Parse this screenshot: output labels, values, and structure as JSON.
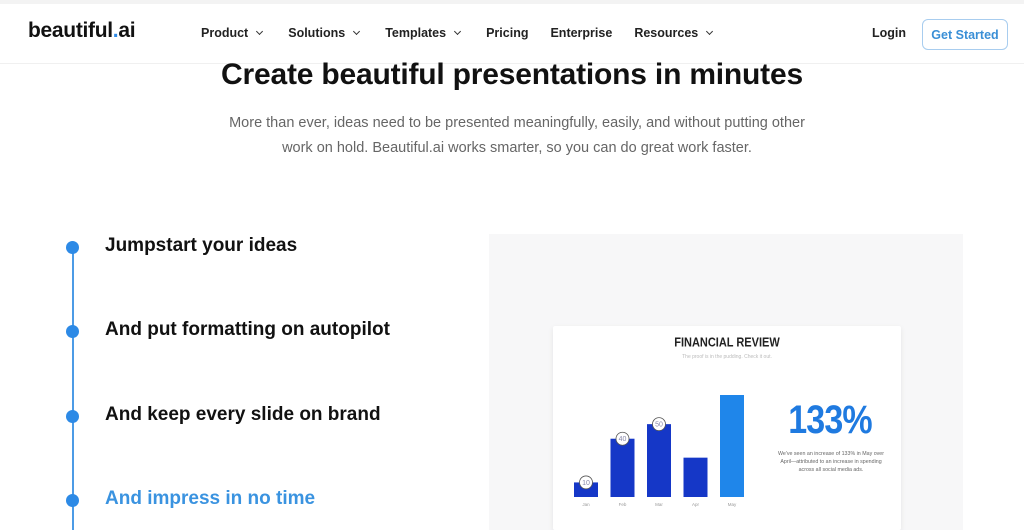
{
  "nav": {
    "logo": {
      "text": "beautiful",
      "dot": ".",
      "suffix": "ai"
    },
    "menu": [
      {
        "label": "Product",
        "has_dropdown": true
      },
      {
        "label": "Solutions",
        "has_dropdown": true
      },
      {
        "label": "Templates",
        "has_dropdown": true
      },
      {
        "label": "Pricing",
        "has_dropdown": false
      },
      {
        "label": "Enterprise",
        "has_dropdown": false
      },
      {
        "label": "Resources",
        "has_dropdown": true
      }
    ],
    "login_label": "Login",
    "cta_label": "Get Started"
  },
  "hero": {
    "title": "Create beautiful presentations in minutes",
    "subtitle": "More than ever, ideas need to be presented meaningfully, easily, and without putting other work on hold. Beautiful.ai works smarter, so you can do great work faster."
  },
  "steps": [
    {
      "label": "Jumpstart your ideas",
      "active": false
    },
    {
      "label": "And put formatting on autopilot",
      "active": false
    },
    {
      "label": "And keep every slide on brand",
      "active": false
    },
    {
      "label": "And impress in no time",
      "active": true
    }
  ],
  "colors": {
    "accent": "#2d8ae6",
    "bar_dark": "#1537c7",
    "bar_highlight": "#1f86ea",
    "stat": "#1f7ae0"
  },
  "slide": {
    "title": "FINANCIAL REVIEW",
    "subtitle": "The proof is in the pudding. Check it out.",
    "stat": "133%",
    "stat_description": "We've seen an increase of 133% in May over April—attributed to an increase in spending across all social media ads."
  },
  "chart_data": {
    "type": "bar",
    "title": "FINANCIAL REVIEW",
    "categories": [
      "Jan",
      "Feb",
      "Mar",
      "Apr",
      "May"
    ],
    "values": [
      10,
      40,
      50,
      27,
      70
    ],
    "data_labels": [
      "10",
      "40",
      "50",
      null,
      null
    ],
    "highlight": "May",
    "xlabel": "",
    "ylabel": "",
    "ylim": [
      0,
      70
    ],
    "grid": false
  }
}
